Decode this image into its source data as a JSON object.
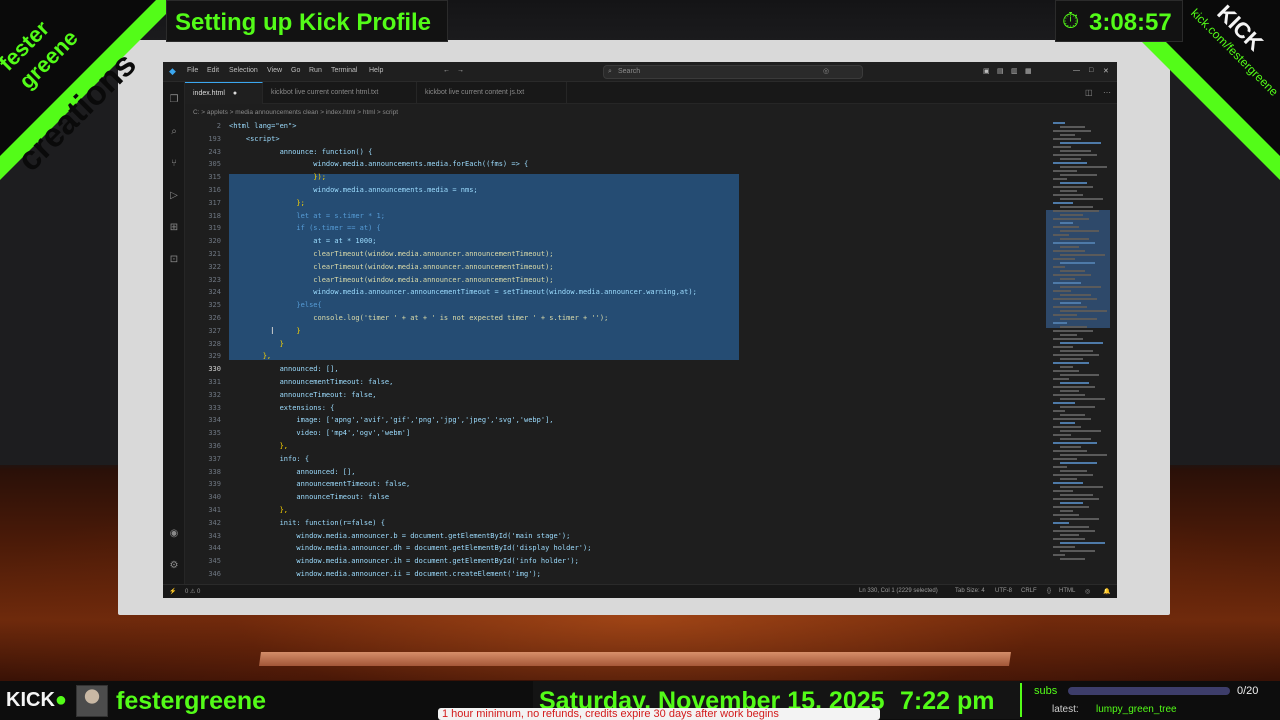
{
  "stream": {
    "title": "Setting up Kick Profile",
    "timer": "3:08:57",
    "brand_line1": "fester",
    "brand_line2": "greene",
    "brand_line3": "creations",
    "kick_logo": "KICK",
    "kick_url": "kick.com/festergreene",
    "accent_color": "#53fc18"
  },
  "bottom_bar": {
    "kick_logo": "KICK",
    "username": "festergreene",
    "date": "Saturday, November 15, 2025",
    "time": "7:22 pm",
    "subs_label": "subs",
    "subs_count": "0/20",
    "subs_progress": 0,
    "latest_label": "latest:",
    "latest_name": "lumpy_green_tree",
    "ticker": "1 hour minimum, no refunds, credits expire 30 days after work begins"
  },
  "vscode": {
    "menu": [
      "File",
      "Edit",
      "Selection",
      "View",
      "Go",
      "Run",
      "Terminal",
      "Help"
    ],
    "search_placeholder": "Search",
    "tabs": [
      {
        "label": "index.html",
        "modified": true,
        "active": true
      },
      {
        "label": "kickbot live current content html.txt",
        "active": false
      },
      {
        "label": "kickbot live current content js.txt",
        "active": false
      }
    ],
    "breadcrumb": "C: > applets > media announcements clean > index.html > html > script",
    "lines": [
      {
        "n": "2",
        "code": "<html lang=\"en\">"
      },
      {
        "n": "193",
        "code": "    <script>"
      },
      {
        "n": "243",
        "code": "            announce: function() {"
      },
      {
        "n": "305",
        "code": "                    window.media.announcements.media.forEach((fms) => {"
      },
      {
        "n": "315",
        "code": "                    });"
      },
      {
        "n": "316",
        "code": "                    window.media.announcements.media = nms;"
      },
      {
        "n": "317",
        "code": "                };"
      },
      {
        "n": "318",
        "code": "                let at = s.timer * 1;"
      },
      {
        "n": "319",
        "code": "                if (s.timer == at) {"
      },
      {
        "n": "320",
        "code": "                    at = at * 1000;"
      },
      {
        "n": "321",
        "code": "                    clearTimeout(window.media.announcer.announcementTimeout);"
      },
      {
        "n": "322",
        "code": "                    clearTimeout(window.media.announcer.announcementTimeout);"
      },
      {
        "n": "323",
        "code": "                    clearTimeout(window.media.announcer.announcementTimeout);"
      },
      {
        "n": "324",
        "code": "                    window.media.announcer.announcementTimeout = setTimeout(window.media.announcer.warning,at);"
      },
      {
        "n": "325",
        "code": "                }else{"
      },
      {
        "n": "326",
        "code": "                    console.log('timer ' + at + ' is not expected timer ' + s.timer + '');"
      },
      {
        "n": "327",
        "code": "                }"
      },
      {
        "n": "328",
        "code": "            }"
      },
      {
        "n": "329",
        "code": "        },"
      },
      {
        "n": "330",
        "code": "            announced: [],"
      },
      {
        "n": "331",
        "code": "            announcementTimeout: false,"
      },
      {
        "n": "332",
        "code": "            announceTimeout: false,"
      },
      {
        "n": "333",
        "code": "            extensions: {"
      },
      {
        "n": "334",
        "code": "                image: ['apng','avif','gif','png','jpg','jpeg','svg','webp'],"
      },
      {
        "n": "335",
        "code": "                video: ['mp4','ogv','webm']"
      },
      {
        "n": "336",
        "code": "            },"
      },
      {
        "n": "337",
        "code": "            info: {"
      },
      {
        "n": "338",
        "code": "                announced: [],"
      },
      {
        "n": "339",
        "code": "                announcementTimeout: false,"
      },
      {
        "n": "340",
        "code": "                announceTimeout: false"
      },
      {
        "n": "341",
        "code": "            },"
      },
      {
        "n": "342",
        "code": "            init: function(r=false) {"
      },
      {
        "n": "343",
        "code": "                window.media.announcer.b = document.getElementById('main stage');"
      },
      {
        "n": "344",
        "code": "                window.media.announcer.dh = document.getElementById('display holder');"
      },
      {
        "n": "345",
        "code": "                window.media.announcer.ih = document.getElementById('info holder');"
      },
      {
        "n": "346",
        "code": "                window.media.announcer.ii = document.createElement('img');"
      }
    ],
    "current_line": "330",
    "status": {
      "left": "0 ⚠ 0",
      "position": "Ln 330, Col 1 (2229 selected)",
      "tab_size": "Tab Size: 4",
      "encoding": "UTF-8",
      "eol": "CRLF",
      "language": "HTML"
    }
  }
}
